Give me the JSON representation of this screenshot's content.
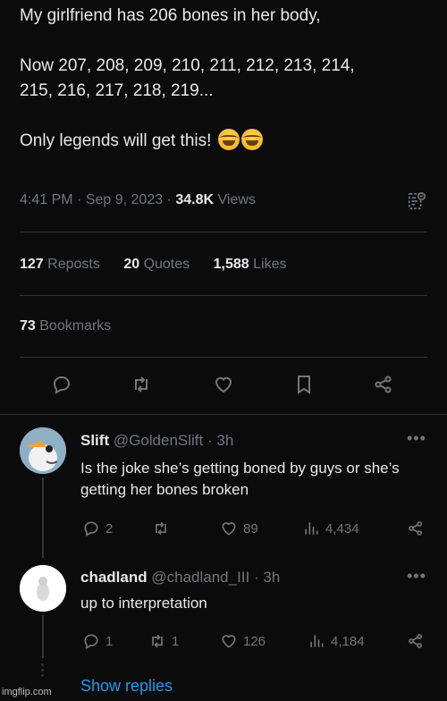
{
  "tweet": {
    "line1": "My girlfriend has 206 bones in her body,",
    "line2": "Now 207, 208, 209, 210, 211, 212, 213, 214,",
    "line3": "215, 216, 217, 218, 219...",
    "line4": "Only legends will get this!",
    "emojis": [
      "face-with-tears-of-joy",
      "face-with-tears-of-joy"
    ],
    "time": "4:41 PM",
    "date": "Sep 9, 2023",
    "views_count": "34.8K",
    "views_label": "Views"
  },
  "stats": {
    "reposts_count": "127",
    "reposts_label": "Reposts",
    "quotes_count": "20",
    "quotes_label": "Quotes",
    "likes_count": "1,588",
    "likes_label": "Likes",
    "bookmarks_count": "73",
    "bookmarks_label": "Bookmarks"
  },
  "actions": [
    "reply-icon",
    "repost-icon",
    "like-icon",
    "bookmark-icon",
    "share-icon"
  ],
  "replies": [
    {
      "name": "Slift",
      "handle": "@GoldenSlift",
      "age": "· 3h",
      "text": "Is the joke she’s getting boned by guys or she’s getting her bones broken",
      "replies": "2",
      "reposts": "",
      "likes": "89",
      "views": "4,434"
    },
    {
      "name": "chadland",
      "handle": "@chadland_III",
      "age": "· 3h",
      "text": "up to interpretation",
      "replies": "1",
      "reposts": "1",
      "likes": "126",
      "views": "4,184"
    }
  ],
  "show_replies": "Show replies",
  "watermark": "imgflip.com",
  "colors": {
    "background": "#0b0b0c",
    "text": "#e7e9ea",
    "muted": "#71767b",
    "accent": "#1d9bf0",
    "divider": "#2f3336"
  }
}
